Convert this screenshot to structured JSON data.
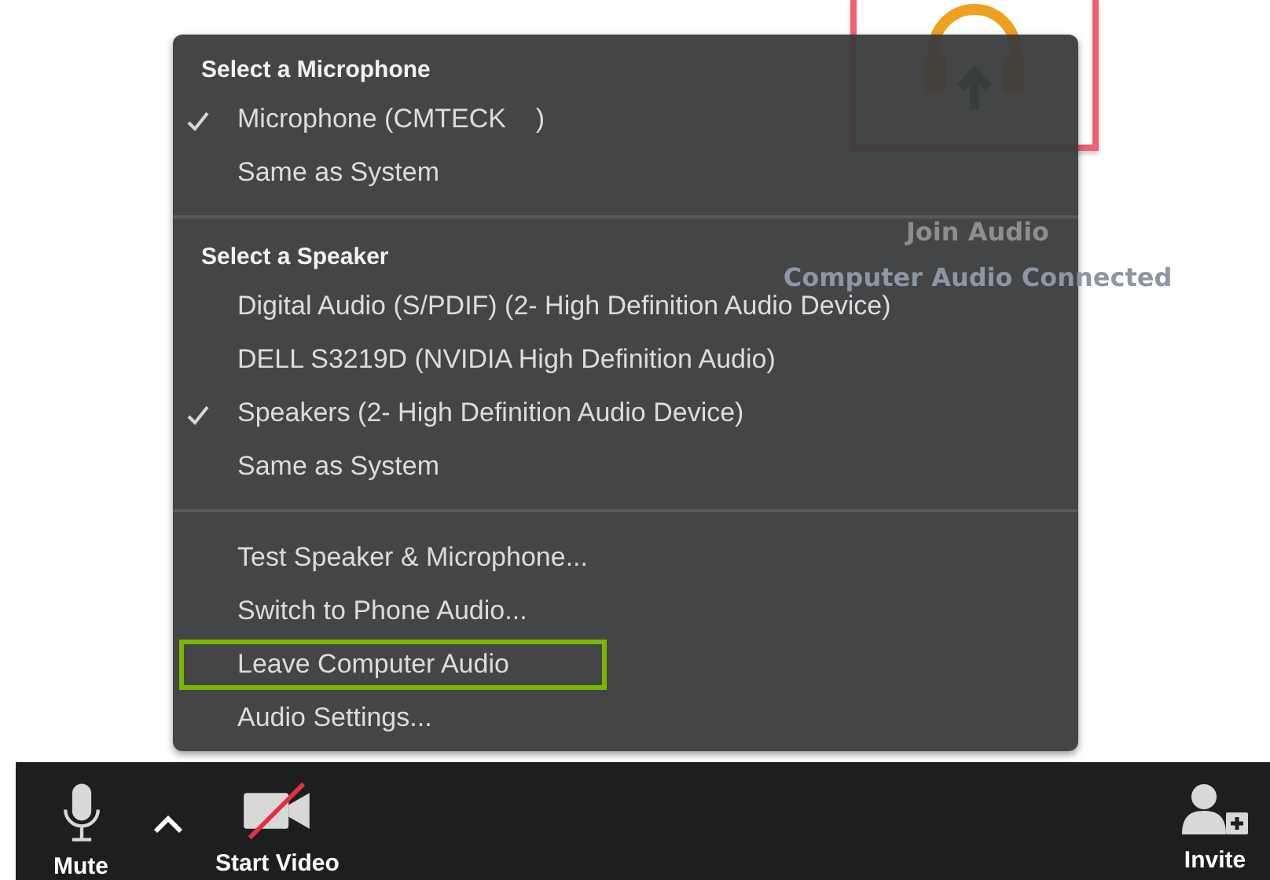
{
  "background": {
    "title": "Join Audio",
    "status": "Computer Audio Connected"
  },
  "menu": {
    "sections": [
      {
        "heading": "Select a Microphone",
        "items": [
          {
            "label": "Microphone (CMTECK    )",
            "checked": true,
            "highlighted": false
          },
          {
            "label": "Same as System",
            "checked": false,
            "highlighted": false
          }
        ]
      },
      {
        "heading": "Select a Speaker",
        "items": [
          {
            "label": "Digital Audio (S/PDIF) (2- High Definition Audio Device)",
            "checked": false,
            "highlighted": false
          },
          {
            "label": "DELL S3219D (NVIDIA High Definition Audio)",
            "checked": false,
            "highlighted": false
          },
          {
            "label": "Speakers (2- High Definition Audio Device)",
            "checked": true,
            "highlighted": false
          },
          {
            "label": "Same as System",
            "checked": false,
            "highlighted": false
          }
        ]
      },
      {
        "items": [
          {
            "label": "Test Speaker & Microphone...",
            "checked": false,
            "highlighted": false
          },
          {
            "label": "Switch to Phone Audio...",
            "checked": false,
            "highlighted": false
          },
          {
            "label": "Leave Computer Audio",
            "checked": false,
            "highlighted": true
          },
          {
            "label": "Audio Settings...",
            "checked": false,
            "highlighted": false
          }
        ]
      }
    ]
  },
  "toolbar": {
    "items": [
      {
        "kind": "mic",
        "label": "Mute"
      },
      {
        "kind": "caret"
      },
      {
        "kind": "video-off",
        "label": "Start Video"
      },
      {
        "kind": "spacer"
      },
      {
        "kind": "invite",
        "label": "Invite"
      }
    ]
  }
}
